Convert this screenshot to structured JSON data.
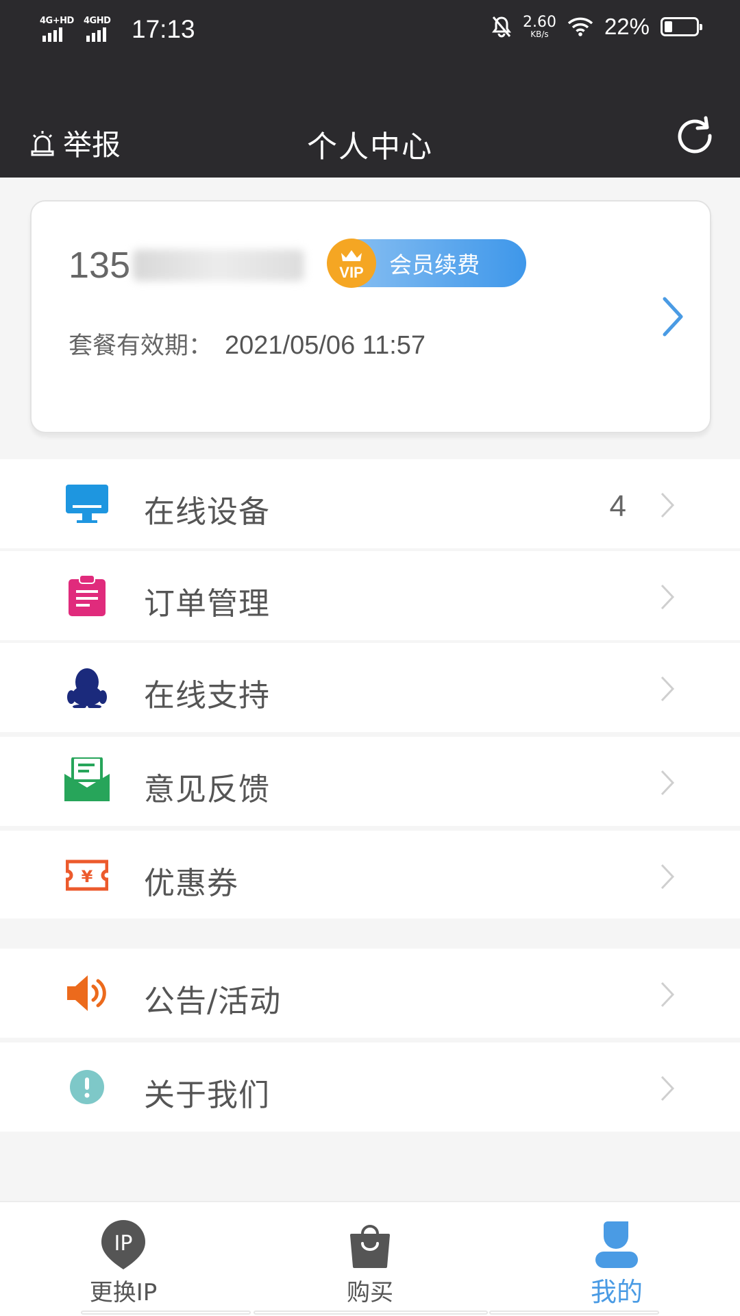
{
  "status_bar": {
    "signal1_label": "4G+HD",
    "signal2_label": "4GHD",
    "time": "17:13",
    "net_speed_value": "2.60",
    "net_speed_unit": "KB/s",
    "battery_percent": "22%",
    "battery_level": 0.22
  },
  "header": {
    "report_label": "举报",
    "title": "个人中心",
    "refresh_icon": "refresh-icon"
  },
  "account": {
    "phone_prefix": "135",
    "vip_badge_text": "VIP",
    "renew_label": "会员续费",
    "expiry_label": "套餐有效期：",
    "expiry_value": "2021/05/06 11:57"
  },
  "menu": [
    {
      "label": "在线设备",
      "count": "4",
      "icon": "monitor-icon",
      "color": "#1e96e0"
    },
    {
      "label": "订单管理",
      "icon": "clipboard-icon",
      "color": "#e02b7c"
    },
    {
      "label": "在线支持",
      "icon": "qq-penguin-icon",
      "color": "#1b2a7c"
    },
    {
      "label": "意见反馈",
      "icon": "mail-icon",
      "color": "#27a55a"
    },
    {
      "label": "优惠券",
      "icon": "coupon-icon",
      "color": "#ec5a2c"
    },
    {
      "label": "公告/活动",
      "icon": "speaker-icon",
      "color": "#ec6a1c"
    },
    {
      "label": "关于我们",
      "icon": "info-icon",
      "color": "#7ec8c8"
    }
  ],
  "bottom_nav": [
    {
      "label": "更换IP",
      "icon": "ip-pin-icon",
      "active": false
    },
    {
      "label": "购买",
      "icon": "shopping-bag-icon",
      "active": false
    },
    {
      "label": "我的",
      "icon": "user-icon",
      "active": true
    }
  ],
  "colors": {
    "header_bg": "#2b2a2d",
    "accent": "#4a9be4",
    "page_bg": "#f5f5f5"
  }
}
